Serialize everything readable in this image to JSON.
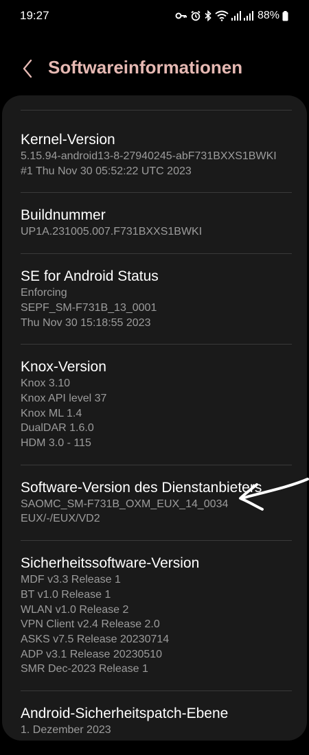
{
  "status_bar": {
    "time": "19:27",
    "battery": "88%",
    "icons": [
      "key-icon",
      "alarm-icon",
      "bluetooth-icon",
      "wifi-icon",
      "signal-icon",
      "signal-icon",
      "battery-icon"
    ]
  },
  "header": {
    "back_icon": "chevron-left-icon",
    "title": "Softwareinformationen"
  },
  "colors": {
    "title": "#e6b9b3",
    "card_bg": "#1a1a1a",
    "secondary_text": "#9c9c9c"
  },
  "items": [
    {
      "title": "Kernel-Version",
      "lines": [
        "5.15.94-android13-8-27940245-abF731BXXS1BWKI",
        "#1 Thu Nov 30 05:52:22 UTC 2023"
      ]
    },
    {
      "title": "Buildnummer",
      "lines": [
        "UP1A.231005.007.F731BXXS1BWKI"
      ]
    },
    {
      "title": "SE for Android Status",
      "lines": [
        "Enforcing",
        "SEPF_SM-F731B_13_0001",
        "Thu Nov 30 15:18:55 2023"
      ]
    },
    {
      "title": "Knox-Version",
      "lines": [
        "Knox 3.10",
        "Knox API level 37",
        "Knox ML 1.4",
        "DualDAR 1.6.0",
        "HDM 3.0 - 115"
      ]
    },
    {
      "title": "Software-Version des Dienstanbieters",
      "lines": [
        "SAOMC_SM-F731B_OXM_EUX_14_0034",
        "EUX/-/EUX/VD2"
      ]
    },
    {
      "title": "Sicherheitssoftware-Version",
      "lines": [
        "MDF v3.3 Release 1",
        "BT v1.0 Release 1",
        "WLAN v1.0 Release 2",
        "VPN Client v2.4 Release 2.0",
        "ASKS v7.5  Release 20230714",
        "ADP v3.1 Release 20230510",
        "SMR Dec-2023 Release 1"
      ]
    },
    {
      "title": "Android-Sicherheitspatch-Ebene",
      "lines": [
        "1. Dezember 2023"
      ]
    }
  ],
  "annotation": {
    "arrow_icon": "hand-drawn-arrow-icon"
  }
}
